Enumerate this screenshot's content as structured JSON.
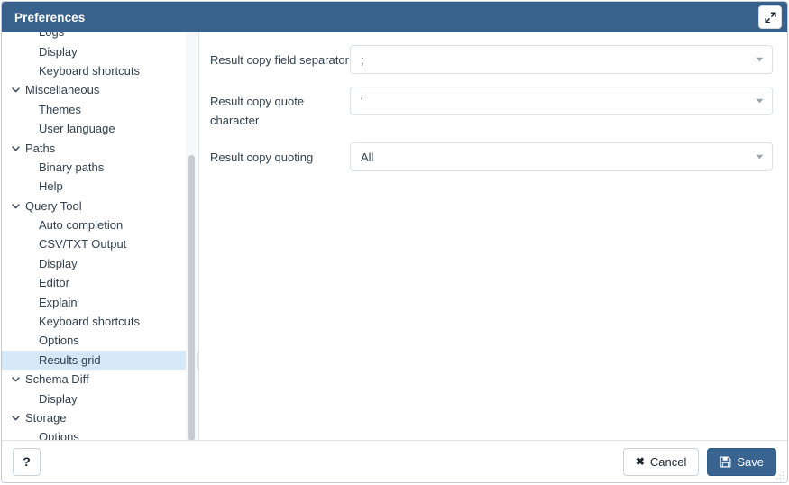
{
  "window": {
    "title": "Preferences",
    "maximize_icon": "expand-diagonal-icon",
    "accent_color": "#38618c",
    "selected_row_color": "#d5e8f7",
    "selected_marker_color": "#2f6ea5"
  },
  "sidebar": {
    "scrollbar": "vertical-scrollbar",
    "items": [
      {
        "label": "Logs",
        "type": "leaf",
        "selected": false,
        "clipped": true
      },
      {
        "label": "Display",
        "type": "leaf",
        "selected": false
      },
      {
        "label": "Keyboard shortcuts",
        "type": "leaf",
        "selected": false
      },
      {
        "label": "Miscellaneous",
        "type": "group",
        "selected": false,
        "icon": "chevron-down-icon"
      },
      {
        "label": "Themes",
        "type": "leaf",
        "selected": false
      },
      {
        "label": "User language",
        "type": "leaf",
        "selected": false
      },
      {
        "label": "Paths",
        "type": "group",
        "selected": false,
        "icon": "chevron-down-icon"
      },
      {
        "label": "Binary paths",
        "type": "leaf",
        "selected": false
      },
      {
        "label": "Help",
        "type": "leaf",
        "selected": false
      },
      {
        "label": "Query Tool",
        "type": "group",
        "selected": false,
        "icon": "chevron-down-icon"
      },
      {
        "label": "Auto completion",
        "type": "leaf",
        "selected": false
      },
      {
        "label": "CSV/TXT Output",
        "type": "leaf",
        "selected": false
      },
      {
        "label": "Display",
        "type": "leaf",
        "selected": false
      },
      {
        "label": "Editor",
        "type": "leaf",
        "selected": false
      },
      {
        "label": "Explain",
        "type": "leaf",
        "selected": false
      },
      {
        "label": "Keyboard shortcuts",
        "type": "leaf",
        "selected": false
      },
      {
        "label": "Options",
        "type": "leaf",
        "selected": false
      },
      {
        "label": "Results grid",
        "type": "leaf",
        "selected": true
      },
      {
        "label": "Schema Diff",
        "type": "group",
        "selected": false,
        "icon": "chevron-down-icon"
      },
      {
        "label": "Display",
        "type": "leaf",
        "selected": false
      },
      {
        "label": "Storage",
        "type": "group",
        "selected": false,
        "icon": "chevron-down-icon"
      },
      {
        "label": "Options",
        "type": "leaf",
        "selected": false
      }
    ]
  },
  "panel": {
    "fields": [
      {
        "label": "Result copy field separator",
        "value": ";",
        "control": "dropdown",
        "icon": "chevron-down-icon"
      },
      {
        "label": "Result copy quote character",
        "value": "'",
        "control": "dropdown",
        "icon": "chevron-down-icon"
      },
      {
        "label": "Result copy quoting",
        "value": "All",
        "control": "dropdown",
        "icon": "chevron-down-icon"
      }
    ]
  },
  "footer": {
    "help_label": "?",
    "help_icon": "question-mark-icon",
    "cancel_label": "Cancel",
    "cancel_icon": "close-x-icon",
    "save_label": "Save",
    "save_icon": "floppy-disk-icon"
  }
}
